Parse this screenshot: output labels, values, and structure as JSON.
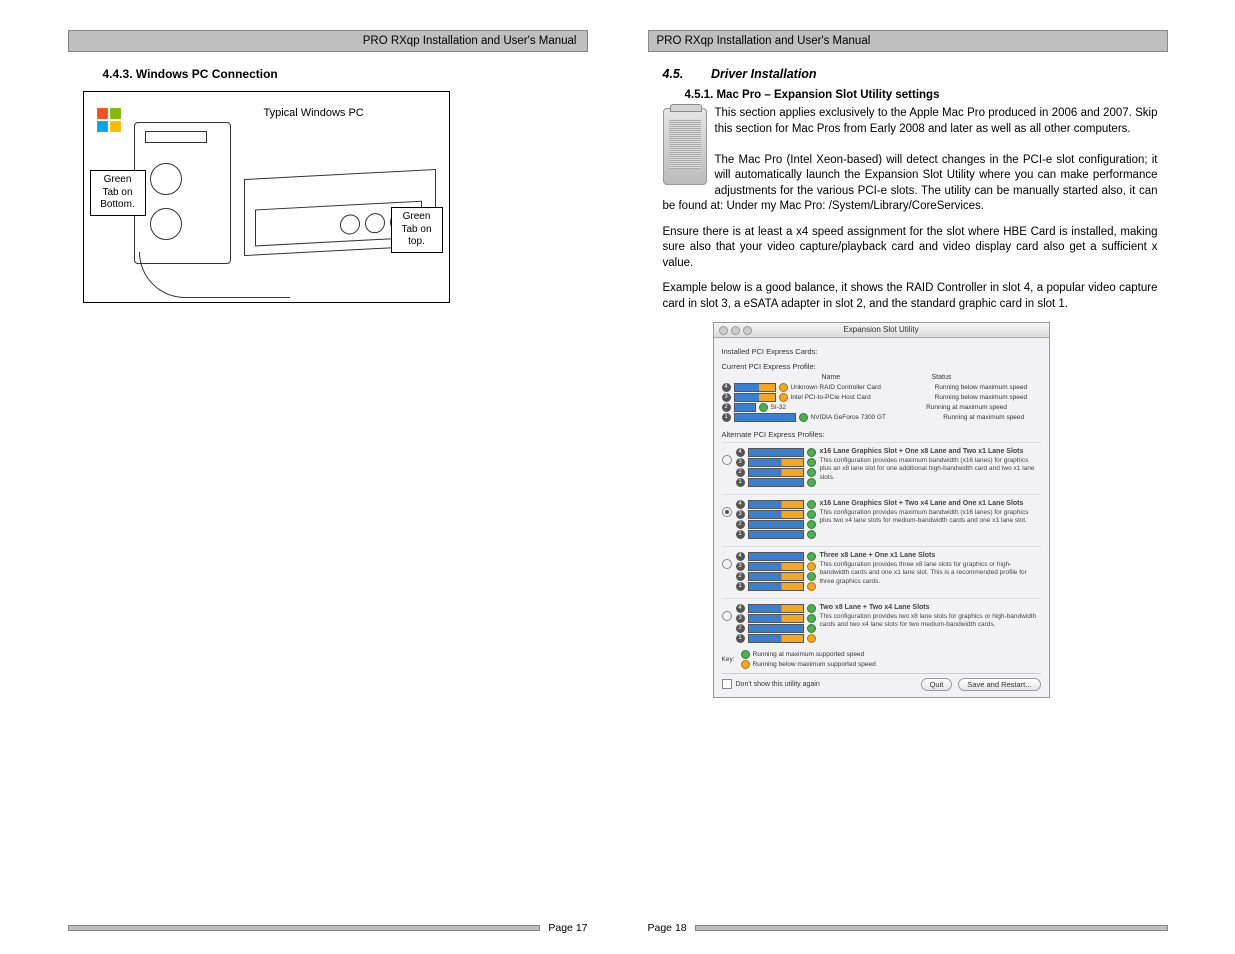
{
  "header": "PRO RXqp Installation and User's Manual",
  "left": {
    "section": "4.4.3. Windows PC Connection",
    "figure": {
      "typical": "Typical Windows PC",
      "label_bottom": "Green\nTab on\nBottom.",
      "label_top": "Green\nTab on\ntop."
    },
    "page_num": "Page 17"
  },
  "right": {
    "section_num": "4.5.",
    "section_title": "Driver Installation",
    "subsection": "4.5.1. Mac Pro – Expansion Slot Utility settings",
    "para1": "This section applies exclusively to the Apple Mac Pro produced in 2006 and 2007.   Skip this section for Mac Pros from Early 2008 and later as well as all other computers.",
    "para2": "The Mac Pro (Intel Xeon-based) will detect changes in the PCI-e slot configuration; it will automatically launch the Expansion Slot Utility where you can make performance adjustments for the various PCI-e slots.  The utility can be manually started also, it can be found at: Under my Mac Pro: /System/Library/CoreServices.",
    "para3": "Ensure there is at least a x4 speed assignment for the slot where HBE Card is installed, making sure also that your video capture/playback card and video display card also get a sufficient x value.",
    "para4": "Example below is a good balance, it shows the RAID Controller in slot 4, a popular video capture card in slot 3, a eSATA adapter in slot 2, and the standard graphic card in slot 1.",
    "screenshot": {
      "title": "Expansion Slot Utility",
      "installed": "Installed PCI Express Cards:",
      "current": "Current PCI Express Profile:",
      "col_name": "Name",
      "col_status": "Status",
      "rows": [
        {
          "name": "Unknown RAID Controller Card",
          "status": "Running below maximum speed"
        },
        {
          "name": "Intel PCI-to-PCIe Host Card",
          "status": "Running below maximum speed"
        },
        {
          "name": "SI-32",
          "status": "Running at maximum speed"
        },
        {
          "name": "NVIDIA GeForce 7300 GT",
          "status": "Running at maximum speed"
        }
      ],
      "alternate": "Alternate PCI Express Profiles:",
      "profiles": [
        {
          "title": "x16 Lane Graphics Slot + One x8 Lane and Two x1 Lane Slots",
          "desc": "This configuration provides maximum bandwidth (x16 lanes) for graphics plus an x8 lane slot for one additional high-bandwidth card and two x1 lane slots."
        },
        {
          "title": "x16 Lane Graphics Slot + Two x4 Lane and One x1 Lane Slots",
          "desc": "This configuration provides maximum bandwidth (x16 lanes) for graphics plus two x4 lane slots for medium-bandwidth cards and one x1 lane slot."
        },
        {
          "title": "Three x8 Lane + One x1 Lane Slots",
          "desc": "This configuration provides three x8 lane slots for graphics or high-bandwidth cards and one x1 lane slot. This is a recommended profile for three graphics cards."
        },
        {
          "title": "Two x8 Lane + Two x4 Lane Slots",
          "desc": "This configuration provides two x8 lane slots for graphics or high-bandwidth cards and two x4 lane slots for two medium-bandwidth cards."
        }
      ],
      "key_label": "Key:",
      "key_green": "Running at maximum supported speed",
      "key_orange": "Running below maximum supported speed",
      "dont_show": "Don't show this utility again",
      "quit": "Quit",
      "save": "Save and Restart..."
    },
    "page_num": "Page 18"
  }
}
